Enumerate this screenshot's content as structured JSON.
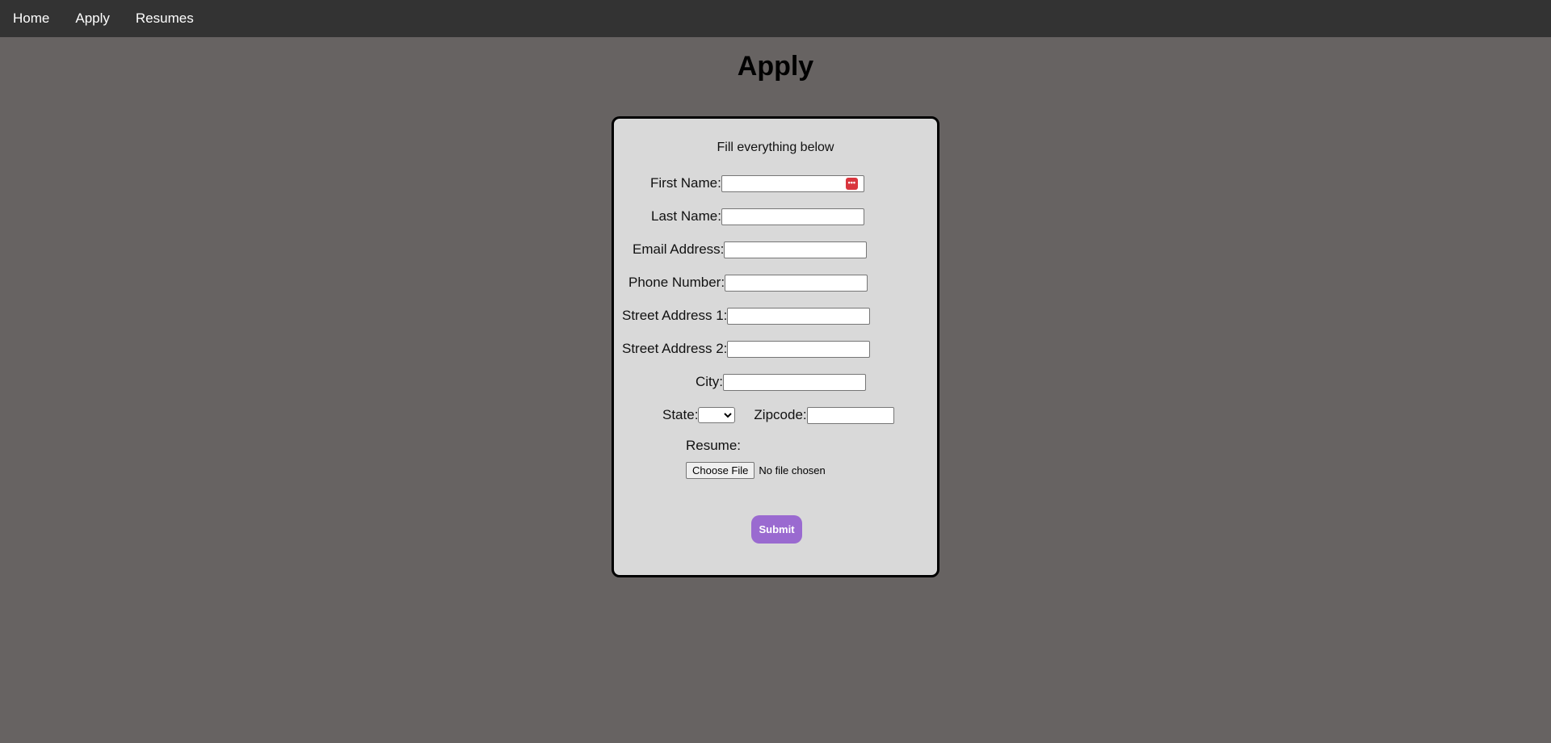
{
  "nav": {
    "items": [
      {
        "label": "Home"
      },
      {
        "label": "Apply"
      },
      {
        "label": "Resumes"
      }
    ]
  },
  "page": {
    "title": "Apply"
  },
  "form": {
    "subtitle": "Fill everything below",
    "fields": {
      "first_name": {
        "label": "First Name:",
        "value": ""
      },
      "last_name": {
        "label": "Last Name:",
        "value": ""
      },
      "email": {
        "label": "Email Address:",
        "value": ""
      },
      "phone": {
        "label": "Phone Number:",
        "value": ""
      },
      "street1": {
        "label": "Street Address 1:",
        "value": ""
      },
      "street2": {
        "label": "Street Address 2:",
        "value": ""
      },
      "city": {
        "label": "City:",
        "value": ""
      },
      "state": {
        "label": "State:",
        "value": ""
      },
      "zipcode": {
        "label": "Zipcode:",
        "value": ""
      }
    },
    "resume": {
      "label": "Resume:",
      "button_label": "Choose File",
      "status": "No file chosen"
    },
    "submit_label": "Submit"
  },
  "icons": {
    "password_manager": "password-manager-icon",
    "select_chevron": "chevron-down-icon"
  },
  "colors": {
    "nav_background": "#333333",
    "page_background": "#676362",
    "card_background": "#d9d9d9",
    "submit_button": "#9a6ad0",
    "password_icon": "#d9363e"
  }
}
